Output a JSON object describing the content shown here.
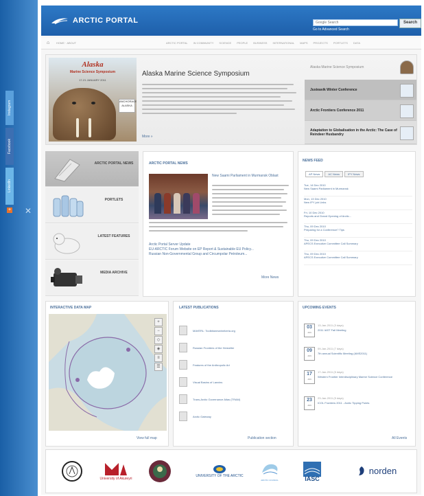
{
  "left_rail": {
    "tabs": [
      "Instagram",
      "Facebook",
      "LinkedIn"
    ],
    "plus": "+"
  },
  "header": {
    "logo_text": "ARCTIC PORTAL",
    "search_placeholder": "Google Search",
    "search_button": "Search",
    "advanced_search": "Go to Advanced Search"
  },
  "navbar": {
    "breadcrumb": "HOME · ABOUT",
    "menu": [
      "ARCTIC PORTAL",
      "IN COMMUNITY",
      "SCIENCE",
      "PEOPLE",
      "BUSINESS",
      "INTERNATIONAL",
      "MAPS",
      "PROJECTS",
      "PORTLETS",
      "DATA"
    ]
  },
  "hero": {
    "image_title": "Alaska",
    "image_subtitle": "Marine Science Symposium",
    "image_dates": "17-21 JANUARY 2011",
    "image_badge": "ANCHORAGE ALASKA",
    "title": "Alaska Marine Science Symposium",
    "more": "More »",
    "list": [
      "Alaska Marine Science Symposium",
      "Justeavik Winter Conference",
      "Arctic Frontiers Conference 2011",
      "Adaptation to Globalisation in the Arctic: The Case of Reindeer Husbandry"
    ]
  },
  "categories": [
    {
      "label": "ARCTIC PORTAL NEWS"
    },
    {
      "label": "PORTLETS"
    },
    {
      "label": "LATEST FEATURES"
    },
    {
      "label": "MEDIA ARCHIVE"
    }
  ],
  "news": {
    "heading": "ARCTIC PORTAL NEWS",
    "title": "New Saami Parliament in Murmansk Oblast",
    "body_lines": 11,
    "sub_title": "Arctic Portal Server Update",
    "sub_text": "EU-ARCTIC Forum Website on EP Report & Sustainable EU Policy...",
    "sub_text2": "Russian Non-Governmental Group and Circumpolar Petroleum...",
    "more": "More News"
  },
  "newsfeed": {
    "heading": "NEWS FEED",
    "tabs": [
      "AP News",
      "AC News",
      "IPY News"
    ],
    "items": [
      {
        "date": "Tue, 14 Dec 2010",
        "text": "New Saami Parliament in Murmansk"
      },
      {
        "date": "Mon, 13 Dec 2010",
        "text": "New IPY job Links"
      },
      {
        "date": "Fri, 10 Dec 2010",
        "text": "Reports and Grand Opening of Arctic..."
      },
      {
        "date": "Thu, 09 Dec 2010",
        "text": "Preparing for a Conference? Tips"
      },
      {
        "date": "Thu, 09 Dec 2010",
        "text": "APECS Executive Committee Call Summary"
      },
      {
        "date": "Thu, 09 Dec 2010",
        "text": "APECS Executive Committee Call Summary"
      }
    ]
  },
  "map": {
    "heading": "INTERACTIVE DATA MAP",
    "controls": [
      "+",
      "−",
      "◇",
      "◈",
      "≡",
      "☰"
    ],
    "link": "View full map"
  },
  "pubs": {
    "heading": "LATEST PUBLICATIONS",
    "items": [
      "MAVERL: Toolkitanmarinekeria.org",
      "Russian Frontiers of the Hereafter",
      "Features of the Anthropolic Art",
      "Visual Basins of Lanxins",
      "Trans-Arctic Governance Atlas (TRAM)",
      "Arctic Gateway"
    ],
    "link": "Publication section"
  },
  "events": {
    "heading": "UPCOMING EVENTS",
    "items": [
      {
        "day": "03",
        "mon": "JAN",
        "date": "13-Jan-2011 (3 days)",
        "title": "2011 IAST Fall Meeting"
      },
      {
        "day": "09",
        "mon": "JAN",
        "date": "09-Jan-2011 (7 days)",
        "title": "7th annual Scientific Meeting (AMS2011)"
      },
      {
        "day": "17",
        "mon": "JAN",
        "date": "17-Jan-2011 (5 days)",
        "title": "Western Frontier Interdisciplinary Marine Science Conference"
      },
      {
        "day": "23",
        "mon": "JAN",
        "date": "23-Jan-2011 (5 days)",
        "title": "ICOL Frontiers 2011 - Arctic Tipping Points"
      }
    ],
    "link": "All Events"
  },
  "partners": [
    {
      "name": ""
    },
    {
      "name": "University of Akureyri"
    },
    {
      "name": ""
    },
    {
      "name": "UNIVERSITY OF THE ARCTIC"
    },
    {
      "name": "ARCTIC COUNCIL"
    },
    {
      "name": "IASC"
    },
    {
      "name": "norden"
    }
  ],
  "colors": {
    "header_blue": "#2d79c6",
    "link_blue": "#4a6f9a",
    "rail_blue": "#1a5fa6"
  }
}
